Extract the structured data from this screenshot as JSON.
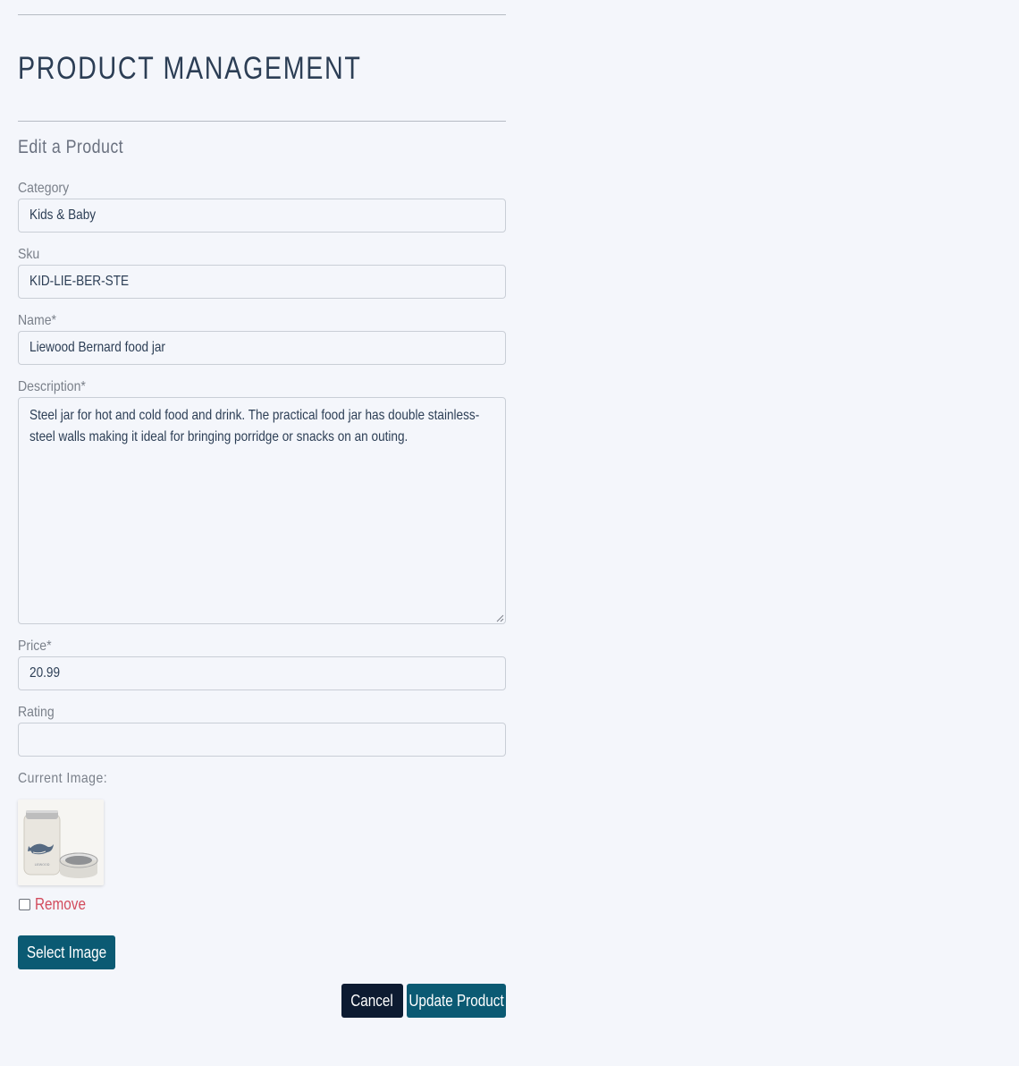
{
  "page": {
    "title": "PRODUCT MANAGEMENT",
    "subtitle": "Edit a Product"
  },
  "form": {
    "category": {
      "label": "Category",
      "value": "Kids & Baby"
    },
    "sku": {
      "label": "Sku",
      "value": "KID-LIE-BER-STE"
    },
    "name": {
      "label": "Name*",
      "value": "Liewood Bernard food jar"
    },
    "description": {
      "label": "Description*",
      "value": "Steel jar for hot and cold food and drink. The practical food jar has double stainless-steel walls making it ideal for bringing porridge or snacks on an outing."
    },
    "price": {
      "label": "Price*",
      "value": "20.99"
    },
    "rating": {
      "label": "Rating",
      "value": ""
    },
    "current_image": {
      "label": "Current Image:",
      "image_alt": "food jar product image",
      "jar_text": "LIEWOOD",
      "remove_label": "Remove",
      "remove_checked": false
    }
  },
  "buttons": {
    "select_image": "Select Image",
    "cancel": "Cancel",
    "update": "Update Product"
  },
  "colors": {
    "background": "#f4f6fb",
    "primary": "#0b5a73",
    "dark": "#0d1b31",
    "danger": "#d24b5c"
  }
}
